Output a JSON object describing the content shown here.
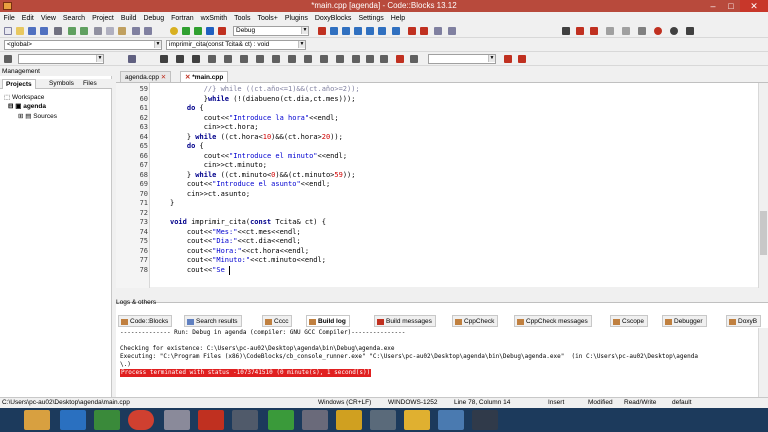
{
  "window": {
    "title": "*main.cpp [agenda] - Code::Blocks 13.12",
    "min": "–",
    "max": "□",
    "close": "✕"
  },
  "menu": [
    "File",
    "Edit",
    "View",
    "Search",
    "Project",
    "Build",
    "Debug",
    "Fortran",
    "wxSmith",
    "Tools",
    "Tools+",
    "Plugins",
    "DoxyBlocks",
    "Settings",
    "Help"
  ],
  "toolbar": {
    "build_target": "Debug",
    "scope": "<global>",
    "function": "imprimir_cita(const Tcita& ct) : void"
  },
  "management": {
    "title": "Management",
    "tabs": [
      "Projects",
      "Symbols",
      "Files"
    ],
    "tree": {
      "workspace": "Workspace",
      "project": "agenda",
      "folder": "Sources"
    }
  },
  "editor": {
    "tabs": [
      "agenda.cpp",
      "*main.cpp"
    ],
    "lines": [
      {
        "n": "59",
        "code": "        //} while ((ct.año<=1)&&(ct.año>=2));"
      },
      {
        "n": "60",
        "code": "        }while (!(diabueno(ct.dia,ct.mes)));"
      },
      {
        "n": "61",
        "code": "    do {"
      },
      {
        "n": "62",
        "code": "        cout<<\"Introduce la hora\"<<endl;"
      },
      {
        "n": "63",
        "code": "        cin>>ct.hora;"
      },
      {
        "n": "64",
        "code": "    } while ((ct.hora<10)&&(ct.hora>20));"
      },
      {
        "n": "65",
        "code": "    do {"
      },
      {
        "n": "66",
        "code": "        cout<<\"Introduce el minuto\"<<endl;"
      },
      {
        "n": "67",
        "code": "        cin>>ct.minuto;"
      },
      {
        "n": "68",
        "code": "    } while ((ct.minuto<0)&&(ct.minuto>59));"
      },
      {
        "n": "69",
        "code": "    cout<<\"Introduce el asunto\"<<endl;"
      },
      {
        "n": "70",
        "code": "    cin>>ct.asunto;"
      },
      {
        "n": "71",
        "code": "}"
      },
      {
        "n": "72",
        "code": ""
      },
      {
        "n": "73",
        "code": "void imprimir_cita(const Tcita& ct) {"
      },
      {
        "n": "74",
        "code": "    cout<<\"Mes:\"<<ct.mes<<endl;"
      },
      {
        "n": "75",
        "code": "    cout<<\"Dia:\"<<ct.dia<<endl;"
      },
      {
        "n": "76",
        "code": "    cout<<\"Hora:\"<<ct.hora<<endl;"
      },
      {
        "n": "77",
        "code": "    cout<<\"Minuto:\"<<ct.minuto<<endl;"
      },
      {
        "n": "78",
        "code": "    cout<<\"Se"
      }
    ]
  },
  "logs": {
    "title": "Logs & others",
    "tabs": [
      "Code::Blocks",
      "Search results",
      "Cccc",
      "Build log",
      "Build messages",
      "CppCheck",
      "CppCheck messages",
      "Cscope",
      "Debugger",
      "DoxyB"
    ],
    "lines": [
      "-------------- Run: Debug in agenda (compiler: GNU GCC Compiler)---------------",
      "",
      "Checking for existence: C:\\Users\\pc-au02\\Desktop\\agenda\\bin\\Debug\\agenda.exe",
      "Executing: \"C:\\Program Files (x86)\\CodeBlocks/cb_console_runner.exe\" \"C:\\Users\\pc-au02\\Desktop\\agenda\\bin\\Debug\\agenda.exe\"  (in C:\\Users\\pc-au02\\Desktop\\agenda",
      "\\.)",
      "Process terminated with status -1073741510 (0 minute(s), 1 second(s))"
    ]
  },
  "status": {
    "path": "C:\\Users\\pc-au02\\Desktop\\agenda\\main.cpp",
    "eol": "Windows (CR+LF)",
    "encoding": "WINDOWS-1252",
    "position": "Line 78, Column 14",
    "mode": "Insert",
    "modified": "Modified",
    "rw": "Read/Write",
    "profile": "default"
  }
}
